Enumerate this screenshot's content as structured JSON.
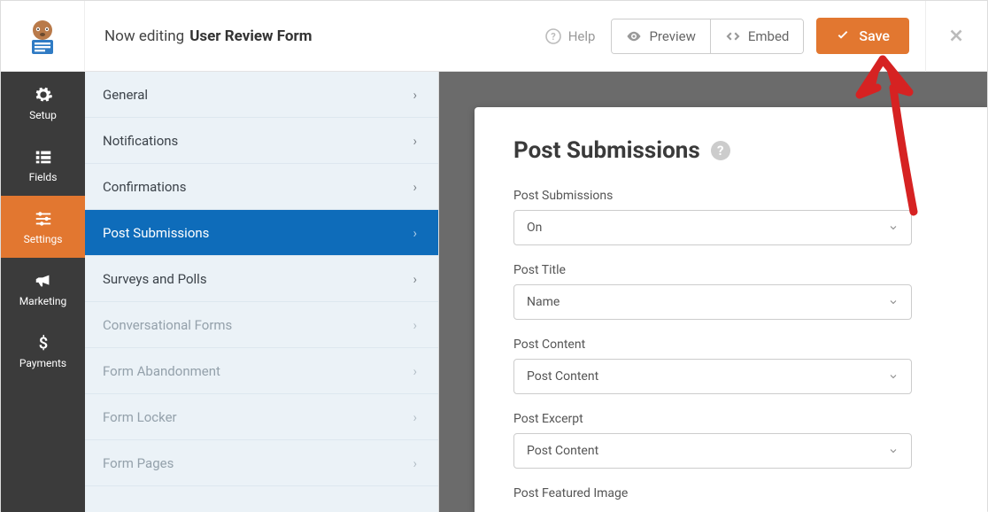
{
  "header": {
    "editing_prefix": "Now editing",
    "form_name": "User Review Form",
    "help_label": "Help",
    "preview_label": "Preview",
    "embed_label": "Embed",
    "save_label": "Save"
  },
  "rail": {
    "items": [
      {
        "label": "Setup",
        "icon": "gear-icon"
      },
      {
        "label": "Fields",
        "icon": "list-icon"
      },
      {
        "label": "Settings",
        "icon": "sliders-icon",
        "active": true
      },
      {
        "label": "Marketing",
        "icon": "bullhorn-icon"
      },
      {
        "label": "Payments",
        "icon": "dollar-icon"
      }
    ]
  },
  "submenu": {
    "items": [
      {
        "label": "General"
      },
      {
        "label": "Notifications"
      },
      {
        "label": "Confirmations"
      },
      {
        "label": "Post Submissions",
        "active": true
      },
      {
        "label": "Surveys and Polls"
      },
      {
        "label": "Conversational Forms",
        "disabled": true
      },
      {
        "label": "Form Abandonment",
        "disabled": true
      },
      {
        "label": "Form Locker",
        "disabled": true
      },
      {
        "label": "Form Pages",
        "disabled": true
      }
    ]
  },
  "panel": {
    "title": "Post Submissions",
    "fields": [
      {
        "label": "Post Submissions",
        "value": "On"
      },
      {
        "label": "Post Title",
        "value": "Name"
      },
      {
        "label": "Post Content",
        "value": "Post Content"
      },
      {
        "label": "Post Excerpt",
        "value": "Post Content"
      },
      {
        "label": "Post Featured Image",
        "value": ""
      }
    ]
  },
  "colors": {
    "accent": "#e27730",
    "submenu_active": "#0e6cba"
  }
}
